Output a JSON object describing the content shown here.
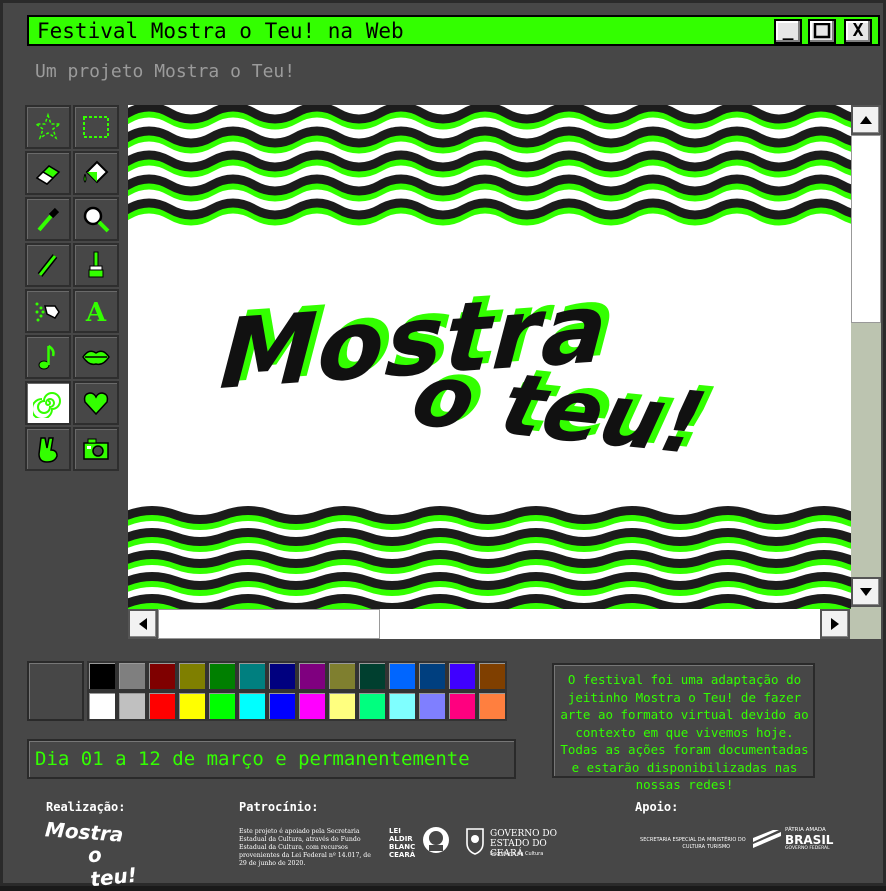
{
  "window": {
    "title": "Festival Mostra o Teu! na Web",
    "minimize_label": "_",
    "maximize_label": "□",
    "close_label": "X"
  },
  "subtitle": "Um projeto Mostra o Teu!",
  "canvas": {
    "art_line1": "Mostra",
    "art_line2": "o teu!"
  },
  "palette": {
    "top_row": [
      "#000000",
      "#7f7f7f",
      "#7f0000",
      "#7f7f00",
      "#007f00",
      "#007f7f",
      "#00007f",
      "#7f007f",
      "#7f7f2f",
      "#003f2f",
      "#0066ff",
      "#003f7f",
      "#3f00ff",
      "#7f3f00"
    ],
    "bottom_row": [
      "#ffffff",
      "#c0c0c0",
      "#ff0000",
      "#ffff00",
      "#00ff00",
      "#00ffff",
      "#0000ff",
      "#ff00ff",
      "#ffff7f",
      "#00ff7f",
      "#7fffff",
      "#7f7fff",
      "#ff007f",
      "#ff7f3f"
    ],
    "current": "#474747"
  },
  "date_text": "Dia 01 a 12 de março e permanentemente",
  "info_text": "O festival foi uma adaptação do jeitinho Mostra o Teu! de fazer arte ao formato virtual devido ao contexto em que vivemos hoje. Todas as ações foram documentadas e estarão disponibilizadas nas nossas redes!",
  "footer": {
    "realizacao_label": "Realização:",
    "patrocinio_label": "Patrocínio:",
    "apoio_label": "Apoio:",
    "logo_line1": "Mostra",
    "logo_line2": "o teu!",
    "patrocinio_text": "Este projeto é apoiado pela Secretaria Estadual da Cultura, através do Fundo Estadual da Cultura, com recursos provenientes da Lei Federal nº 14.017, de 29 de junho de 2020.",
    "lei_aldir_blanc": "LEI ALDIR BLANC CEARÁ",
    "governo": "GOVERNO DO ESTADO DO CEARÁ",
    "governo_sub": "Secretaria da Cultura",
    "apoio_secretaria": "SECRETARIA ESPECIAL DA CULTURA",
    "apoio_ministerio": "MINISTÉRIO DO TURISMO",
    "patria_amada": "PÁTRIA AMADA",
    "brasil": "BRASIL",
    "governo_federal": "GOVERNO FEDERAL"
  },
  "colors": {
    "accent": "#33ff00",
    "window_bg": "#474747",
    "scroll_track": "#bcc4b0"
  }
}
